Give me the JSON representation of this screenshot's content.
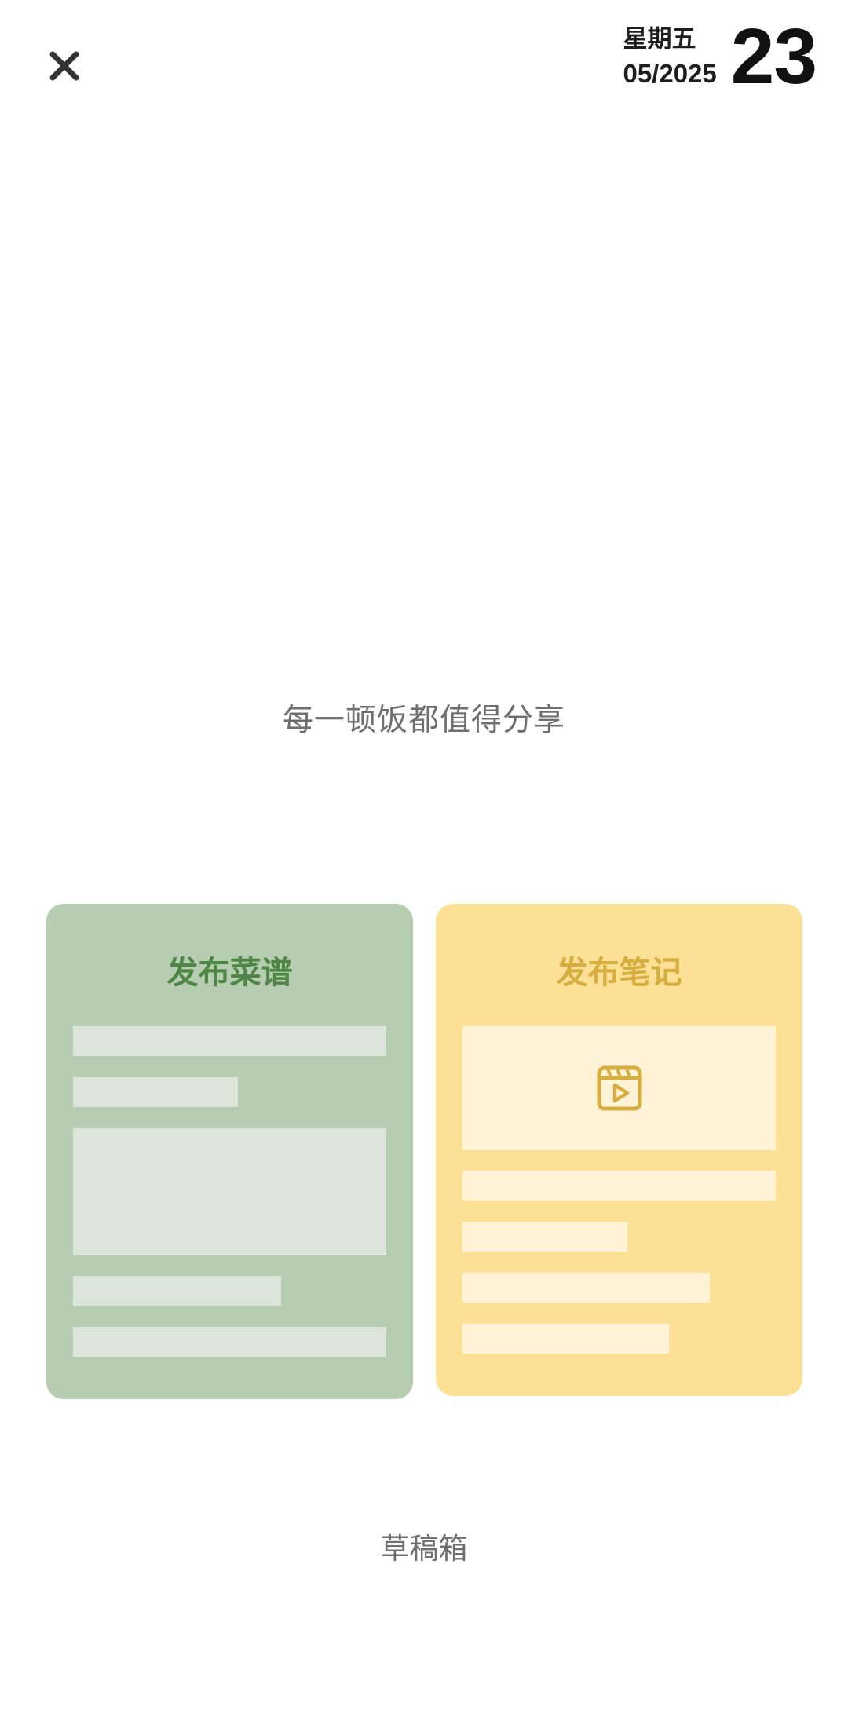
{
  "header": {
    "close_icon": "close-icon",
    "weekday": "星期五",
    "month_year": "05/2025",
    "day": "23"
  },
  "slogan": "每一顿饭都值得分享",
  "cards": {
    "recipe": {
      "title": "发布菜谱",
      "background": "#b7cdb2",
      "title_color": "#4e8645"
    },
    "note": {
      "title": "发布笔记",
      "background": "#fce096",
      "title_color": "#d6ad3f",
      "icon": "video-clip-icon"
    }
  },
  "drafts_label": "草稿箱"
}
